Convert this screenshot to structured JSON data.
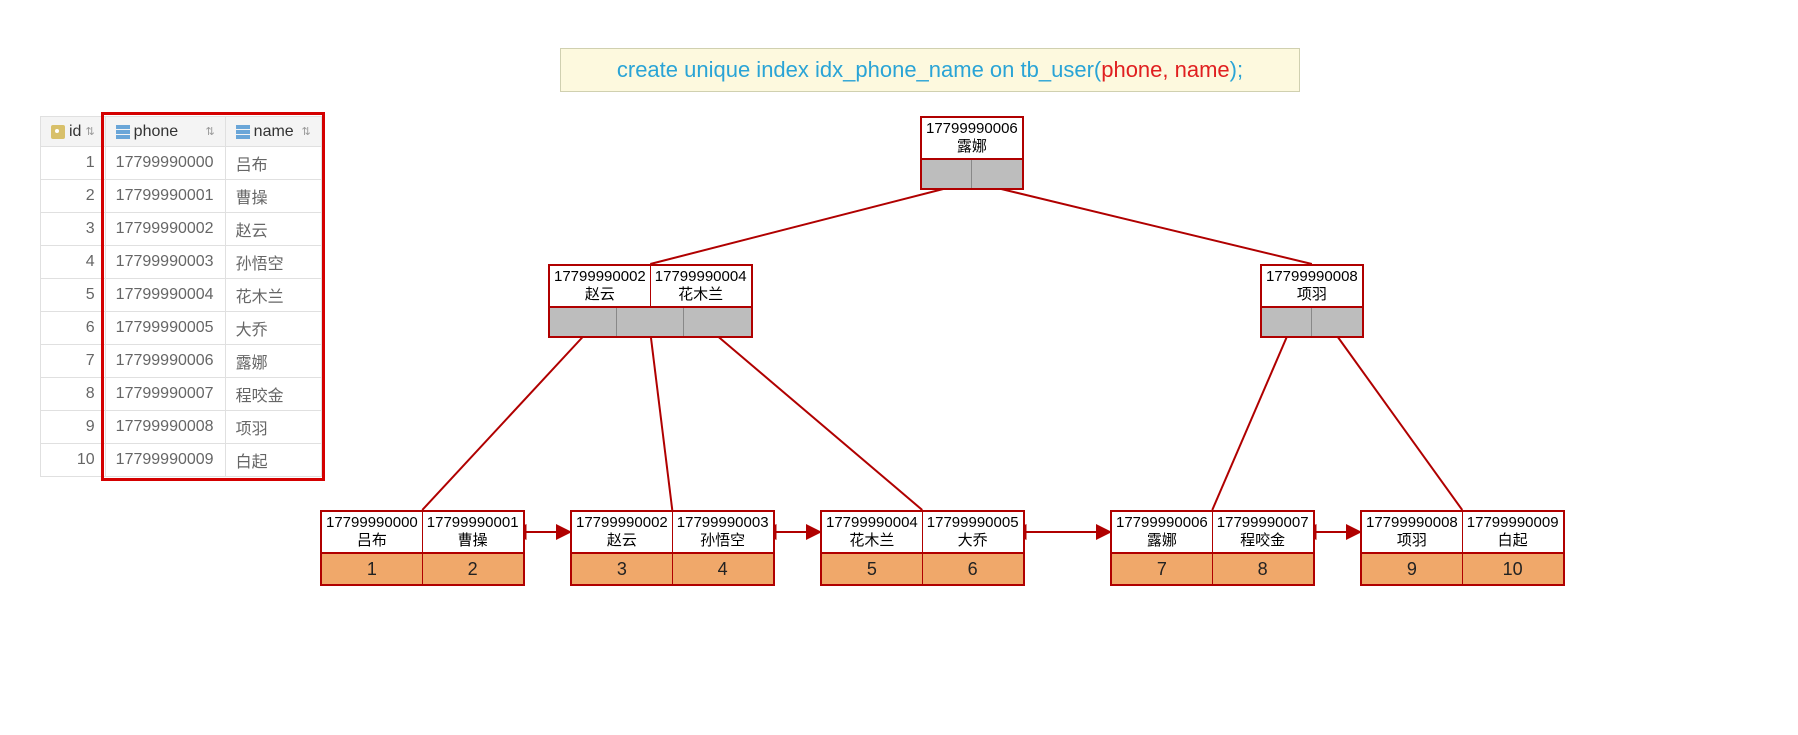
{
  "sql": {
    "prefix": "create unique index idx_phone_name on tb_user(",
    "highlight": "phone, name",
    "suffix": ");"
  },
  "table": {
    "headers": {
      "id": "id",
      "phone": "phone",
      "name": "name"
    },
    "rows": [
      {
        "id": "1",
        "phone": "17799990000",
        "name": "吕布"
      },
      {
        "id": "2",
        "phone": "17799990001",
        "name": "曹操"
      },
      {
        "id": "3",
        "phone": "17799990002",
        "name": "赵云"
      },
      {
        "id": "4",
        "phone": "17799990003",
        "name": "孙悟空"
      },
      {
        "id": "5",
        "phone": "17799990004",
        "name": "花木兰"
      },
      {
        "id": "6",
        "phone": "17799990005",
        "name": "大乔"
      },
      {
        "id": "7",
        "phone": "17799990006",
        "name": "露娜"
      },
      {
        "id": "8",
        "phone": "17799990007",
        "name": "程咬金"
      },
      {
        "id": "9",
        "phone": "17799990008",
        "name": "项羽"
      },
      {
        "id": "10",
        "phone": "17799990009",
        "name": "白起"
      }
    ]
  },
  "tree": {
    "root": {
      "keys": [
        {
          "phone": "17799990006",
          "name": "露娜"
        }
      ]
    },
    "internal": [
      {
        "keys": [
          {
            "phone": "17799990002",
            "name": "赵云"
          },
          {
            "phone": "17799990004",
            "name": "花木兰"
          }
        ]
      },
      {
        "keys": [
          {
            "phone": "17799990008",
            "name": "项羽"
          }
        ]
      }
    ],
    "leaves": [
      {
        "keys": [
          {
            "phone": "17799990000",
            "name": "吕布"
          },
          {
            "phone": "17799990001",
            "name": "曹操"
          }
        ],
        "ids": [
          "1",
          "2"
        ]
      },
      {
        "keys": [
          {
            "phone": "17799990002",
            "name": "赵云"
          },
          {
            "phone": "17799990003",
            "name": "孙悟空"
          }
        ],
        "ids": [
          "3",
          "4"
        ]
      },
      {
        "keys": [
          {
            "phone": "17799990004",
            "name": "花木兰"
          },
          {
            "phone": "17799990005",
            "name": "大乔"
          }
        ],
        "ids": [
          "5",
          "6"
        ]
      },
      {
        "keys": [
          {
            "phone": "17799990006",
            "name": "露娜"
          },
          {
            "phone": "17799990007",
            "name": "程咬金"
          }
        ],
        "ids": [
          "7",
          "8"
        ]
      },
      {
        "keys": [
          {
            "phone": "17799990008",
            "name": "项羽"
          },
          {
            "phone": "17799990009",
            "name": "白起"
          }
        ],
        "ids": [
          "9",
          "10"
        ]
      }
    ]
  }
}
